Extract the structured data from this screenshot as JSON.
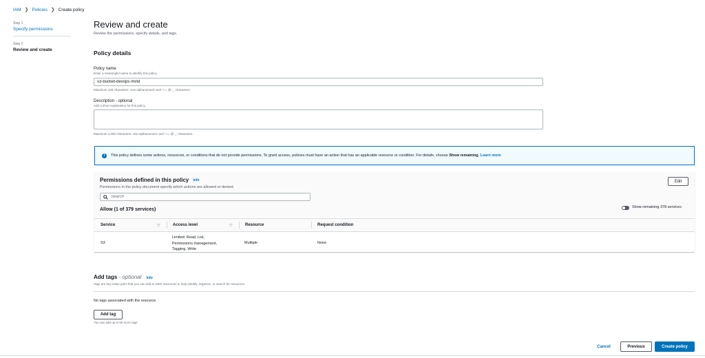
{
  "breadcrumb": {
    "items": [
      "IAM",
      "Policies",
      "Create policy"
    ]
  },
  "steps": [
    {
      "number": "Step 1",
      "label": "Specify permissions"
    },
    {
      "number": "Step 2",
      "label": "Review and create"
    }
  ],
  "header": {
    "title": "Review and create",
    "subtitle": "Review the permissions, specify details, and tags."
  },
  "policy_details": {
    "title": "Policy details",
    "name_label": "Policy name",
    "name_hint": "Enter a meaningful name to identify this policy.",
    "name_value": "s3-bucket-devops-mind",
    "name_constraint": "Maximum 128 characters. Use alphanumeric and '+=,.@-_' characters.",
    "description_label": "Description - optional",
    "description_hint": "Add a short explanation for this policy.",
    "description_value": "",
    "description_constraint": "Maximum 1,000 characters. Use alphanumeric and '+=,.@-_' characters."
  },
  "alert": {
    "icon": "info-icon",
    "text_before": "This policy defines some actions, resources, or conditions that do not provide permissions. To grant access, policies must have an action that has an applicable resource or condition. For details, choose ",
    "text_bold": "Show remaining",
    "text_after": ". ",
    "link": "Learn more"
  },
  "permissions": {
    "title": "Permissions defined in this policy",
    "info": "Info",
    "description": "Permissions in the policy document specify which actions are allowed or denied.",
    "edit_label": "Edit",
    "search_placeholder": "Search",
    "allow_label": "Allow (1 of 379 services)",
    "toggle_label": "Show remaining 378 services",
    "columns": [
      "Service",
      "Access level",
      "Resource",
      "Request condition"
    ],
    "rows": [
      {
        "service": "S3",
        "access_level": [
          "Limited: Read, List,",
          "Permissions management,",
          "Tagging, Write"
        ],
        "resource": "Multiple",
        "request_condition": "None"
      }
    ]
  },
  "tags": {
    "title": "Add tags",
    "optional": " - optional",
    "info": "Info",
    "description": "Tags are key-value pairs that you can add to AWS resources to help identify, organize, or search for resources.",
    "empty": "No tags associated with the resource.",
    "add_label": "Add tag",
    "limit": "You can add up to 50 more tags"
  },
  "footer": {
    "cancel": "Cancel",
    "previous": "Previous",
    "create": "Create policy"
  },
  "colors": {
    "accent": "#0073bb",
    "text": "#16191f",
    "muted": "#687078",
    "border": "#aab7b8"
  }
}
